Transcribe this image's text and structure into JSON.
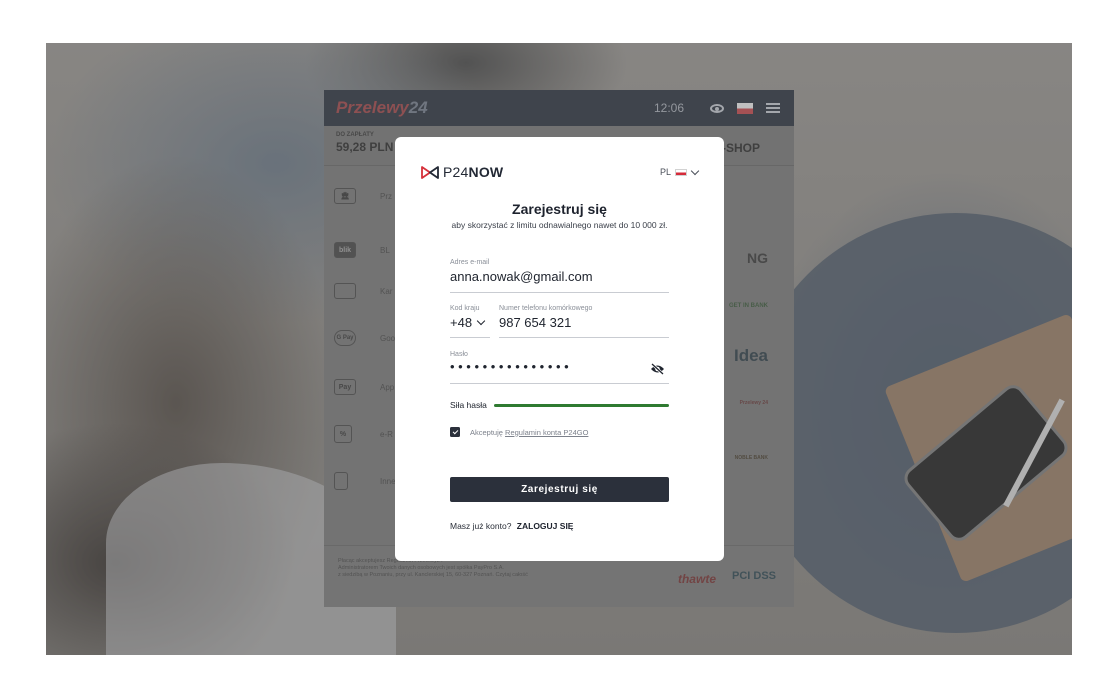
{
  "p24": {
    "logo_main": "Przelewy",
    "logo_num": "24",
    "time": "12:06",
    "to_pay_label": "DO ZAPŁATY",
    "to_pay_value": "59,28 PLN",
    "shop_label": "E-SHOP",
    "methods": [
      {
        "icon_text": "",
        "label": "Prz"
      },
      {
        "icon_text": "blik",
        "label": "BL"
      },
      {
        "icon_text": "",
        "label": "Kar"
      },
      {
        "icon_text": "G Pay",
        "label": "Goo"
      },
      {
        "icon_text": "Pay",
        "label": "App"
      },
      {
        "icon_text": "%",
        "label": "e-R"
      },
      {
        "icon_text": "",
        "label": "Inne"
      }
    ],
    "banks": [
      "NG",
      "GET IN BANK",
      "Idea",
      "Przelewy 24",
      "NOBLE BANK"
    ],
    "footer_line1": "Płacąc akceptujesz Regulamin Przelewy24",
    "footer_line2": "Administratorem Twoich danych osobowych jest spółka PayPro S.A.",
    "footer_line3": "z siedzibą w Poznaniu, przy ul. Kanclerskiej 15, 60-327 Poznań. Czytaj całość",
    "thawte": "thawte",
    "pci": "PCI DSS"
  },
  "modal": {
    "brand_prefix": "P24",
    "brand_bold": "NOW",
    "lang": "PL",
    "title": "Zarejestruj się",
    "subtitle": "aby skorzystać z limitu odnawialnego nawet do 10 000 zł.",
    "email": {
      "label": "Adres e-mail",
      "value": "anna.nowak@gmail.com"
    },
    "country": {
      "label": "Kod kraju",
      "value": "+48"
    },
    "phone": {
      "label": "Numer telefonu komórkowego",
      "value": "987 654 321"
    },
    "password": {
      "label": "Hasło",
      "value": "•••••••••••••••"
    },
    "strength": {
      "label": "Siła hasła",
      "level": 1.0,
      "color": "#2f7a31"
    },
    "terms": {
      "checked": true,
      "prefix": "Akceptuję ",
      "link": "Regulamin konta P24GO"
    },
    "register_button": "Zarejestruj się",
    "login_prompt": "Masz już konto?",
    "login_link": "ZALOGUJ SIĘ"
  }
}
